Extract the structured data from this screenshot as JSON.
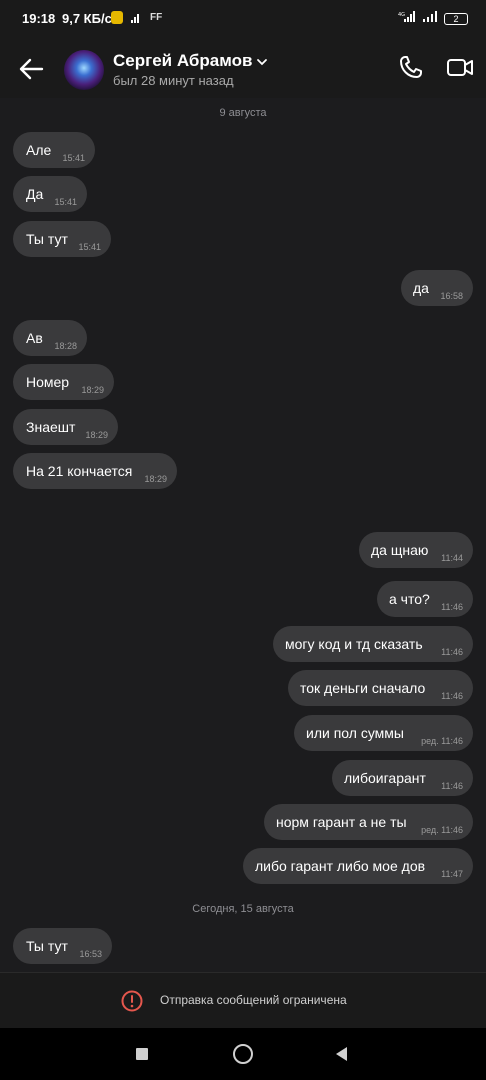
{
  "status_bar": {
    "time": "19:18",
    "speed": "9,7 КБ/с",
    "ff": "FF",
    "battery": "2"
  },
  "header": {
    "name": "Сергей Абрамов",
    "status": "был 28 минут назад"
  },
  "date_separators": [
    "9 августа",
    "Сегодня, 15 августа"
  ],
  "messages": [
    {
      "text": "Але",
      "time": "15:41"
    },
    {
      "text": "Да",
      "time": "15:41"
    },
    {
      "text": "Ты тут",
      "time": "15:41"
    },
    {
      "text": "да",
      "time": "16:58"
    },
    {
      "text": "Ав",
      "time": "18:28"
    },
    {
      "text": "Номер",
      "time": "18:29"
    },
    {
      "text": "Знаешт",
      "time": "18:29"
    },
    {
      "text": "На 21 кончается",
      "time": "18:29"
    },
    {
      "text": "да щнаю",
      "time": "11:44"
    },
    {
      "text": "а что?",
      "time": "11:46"
    },
    {
      "text": "могу код и тд сказать",
      "time": "11:46"
    },
    {
      "text": "ток деньги сначало",
      "time": "11:46"
    },
    {
      "text": "или пол суммы",
      "time": "ред. 11:46"
    },
    {
      "text": "либоигарант",
      "time": "11:46"
    },
    {
      "text": "норм гарант а не ты",
      "time": "ред. 11:46"
    },
    {
      "text": "либо гарант либо мое дов",
      "time": "11:47"
    },
    {
      "text": "Ты тут",
      "time": "16:53"
    }
  ],
  "restriction": {
    "text": "Отправка сообщений ограничена"
  },
  "colors": {
    "background": "#1c1c1e",
    "bubble": "#3a3a3c",
    "warning": "#e5574d"
  }
}
